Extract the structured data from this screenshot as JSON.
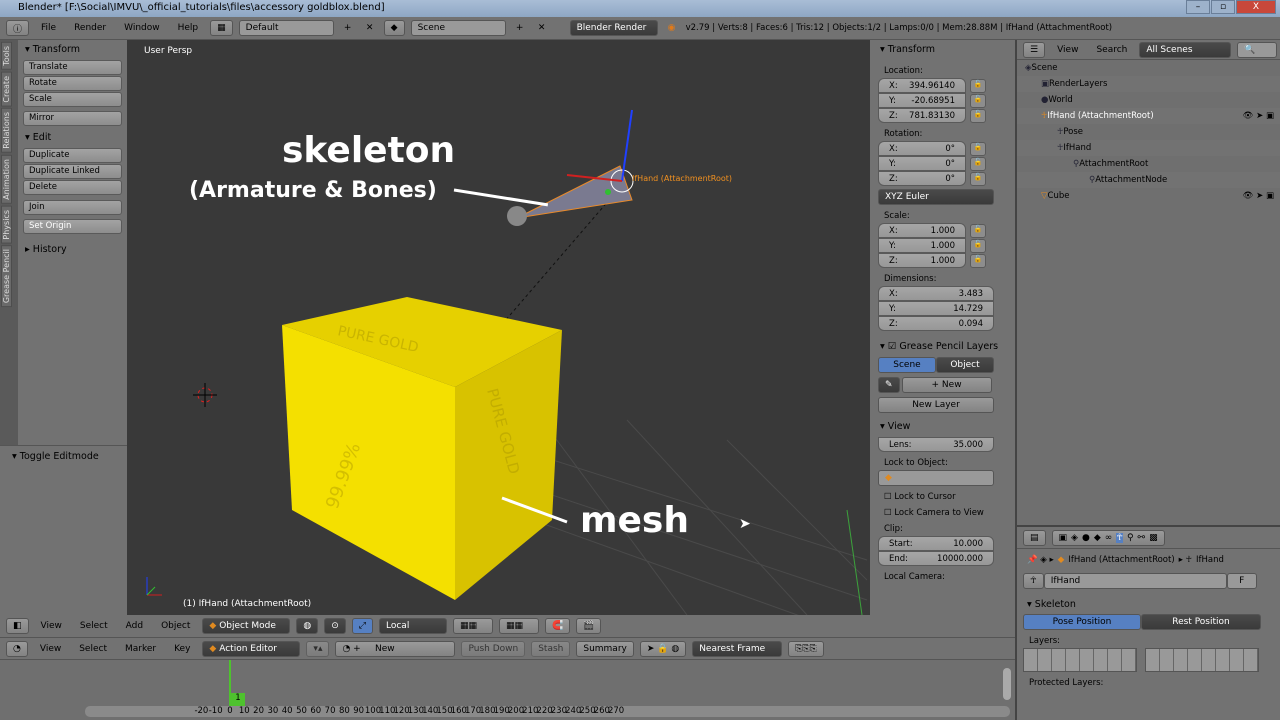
{
  "window": {
    "title": "Blender* [F:\\Social\\IMVU\\_official_tutorials\\files\\accessory goldblox.blend]",
    "minimize": "–",
    "maximize": "▫",
    "close": "X"
  },
  "topbar": {
    "menus": [
      "File",
      "Render",
      "Window",
      "Help"
    ],
    "layout": "Default",
    "scene": "Scene",
    "engine": "Blender Render",
    "stats": "v2.79 | Verts:8 | Faces:6 | Tris:12 | Objects:1/2 | Lamps:0/0 | Mem:28.88M | IfHand (AttachmentRoot)"
  },
  "lefttabs": [
    "Tools",
    "Create",
    "Relations",
    "Animation",
    "Physics",
    "Grease Pencil"
  ],
  "toolshelf": {
    "transform_title": "Transform",
    "transform": [
      "Translate",
      "Rotate",
      "Scale"
    ],
    "mirror": "Mirror",
    "edit_title": "Edit",
    "edit": [
      "Duplicate",
      "Duplicate Linked",
      "Delete"
    ],
    "join": "Join",
    "set_origin": "Set Origin",
    "history": "History"
  },
  "operator_panel": {
    "title": "Toggle Editmode"
  },
  "viewport": {
    "view_label": "User Persp",
    "object_label": "(1) IfHand (AttachmentRoot)",
    "armature_label": "IfHand (AttachmentRoot)",
    "cube_text": [
      "PURE GOLD",
      "99.99%",
      "PURE GOLD"
    ],
    "callout_skeleton": "skeleton",
    "callout_skeleton_sub": "(Armature & Bones)",
    "callout_mesh": "mesh"
  },
  "npanel": {
    "transform_title": "Transform",
    "location_label": "Location:",
    "location": [
      {
        "axis": "X:",
        "value": "394.96140"
      },
      {
        "axis": "Y:",
        "value": "-20.68951"
      },
      {
        "axis": "Z:",
        "value": "781.83130"
      }
    ],
    "rotation_label": "Rotation:",
    "rotation": [
      {
        "axis": "X:",
        "value": "0°"
      },
      {
        "axis": "Y:",
        "value": "0°"
      },
      {
        "axis": "Z:",
        "value": "0°"
      }
    ],
    "rotation_mode": "XYZ Euler",
    "scale_label": "Scale:",
    "scale": [
      {
        "axis": "X:",
        "value": "1.000"
      },
      {
        "axis": "Y:",
        "value": "1.000"
      },
      {
        "axis": "Z:",
        "value": "1.000"
      }
    ],
    "dimensions_label": "Dimensions:",
    "dimensions": [
      {
        "axis": "X:",
        "value": "3.483"
      },
      {
        "axis": "Y:",
        "value": "14.729"
      },
      {
        "axis": "Z:",
        "value": "0.094"
      }
    ],
    "gp_title": "Grease Pencil Layers",
    "gp_scene": "Scene",
    "gp_object": "Object",
    "gp_new": "New",
    "gp_new_layer": "New Layer",
    "view_title": "View",
    "lens_label": "Lens:",
    "lens": "35.000",
    "lock_object_label": "Lock to Object:",
    "lock_cursor": "Lock to Cursor",
    "lock_camera": "Lock Camera to View",
    "clip_label": "Clip:",
    "clip_start_label": "Start:",
    "clip_start": "10.000",
    "clip_end_label": "End:",
    "clip_end": "10000.000",
    "local_camera": "Local Camera:"
  },
  "outliner": {
    "menus": [
      "View",
      "Search"
    ],
    "filter": "All Scenes",
    "items": [
      {
        "label": "Scene",
        "depth": 0,
        "icon": "scene-icon"
      },
      {
        "label": "RenderLayers",
        "depth": 1,
        "icon": "render-layers-icon"
      },
      {
        "label": "World",
        "depth": 1,
        "icon": "world-icon"
      },
      {
        "label": "IfHand (AttachmentRoot)",
        "depth": 1,
        "icon": "armature-object-icon"
      },
      {
        "label": "Pose",
        "depth": 2,
        "icon": "pose-icon"
      },
      {
        "label": "IfHand",
        "depth": 2,
        "icon": "armature-data-icon"
      },
      {
        "label": "AttachmentRoot",
        "depth": 3,
        "icon": "bone-icon"
      },
      {
        "label": "AttachmentNode",
        "depth": 4,
        "icon": "bone-icon"
      },
      {
        "label": "Cube",
        "depth": 1,
        "icon": "mesh-icon"
      }
    ]
  },
  "properties": {
    "breadcrumb_object": "IfHand (AttachmentRoot)",
    "breadcrumb_data": "IfHand",
    "datablock": "IfHand",
    "fake_user": "F",
    "skeleton_title": "Skeleton",
    "pose_position": "Pose Position",
    "rest_position": "Rest Position",
    "layers_label": "Layers:",
    "protected_layers_label": "Protected Layers:"
  },
  "header3d": {
    "menus": [
      "View",
      "Select",
      "Add",
      "Object"
    ],
    "mode": "Object Mode",
    "orientation": "Local"
  },
  "dopesheet": {
    "menus": [
      "View",
      "Select",
      "Marker",
      "Key"
    ],
    "mode": "Action Editor",
    "new": "New",
    "push_down": "Push Down",
    "stash": "Stash",
    "summary": "Summary",
    "snap": "Nearest Frame",
    "current_frame": "1",
    "ticks": [
      "-20",
      "-10",
      "0",
      "10",
      "20",
      "30",
      "40",
      "50",
      "60",
      "70",
      "80",
      "90",
      "100",
      "110",
      "120",
      "130",
      "140",
      "150",
      "160",
      "170",
      "180",
      "190",
      "200",
      "210",
      "220",
      "230",
      "240",
      "250",
      "260",
      "270"
    ]
  },
  "colors": {
    "accent": "#5680c2",
    "gold": "#f2d600",
    "viewport": "#393939",
    "panel": "#727272"
  }
}
